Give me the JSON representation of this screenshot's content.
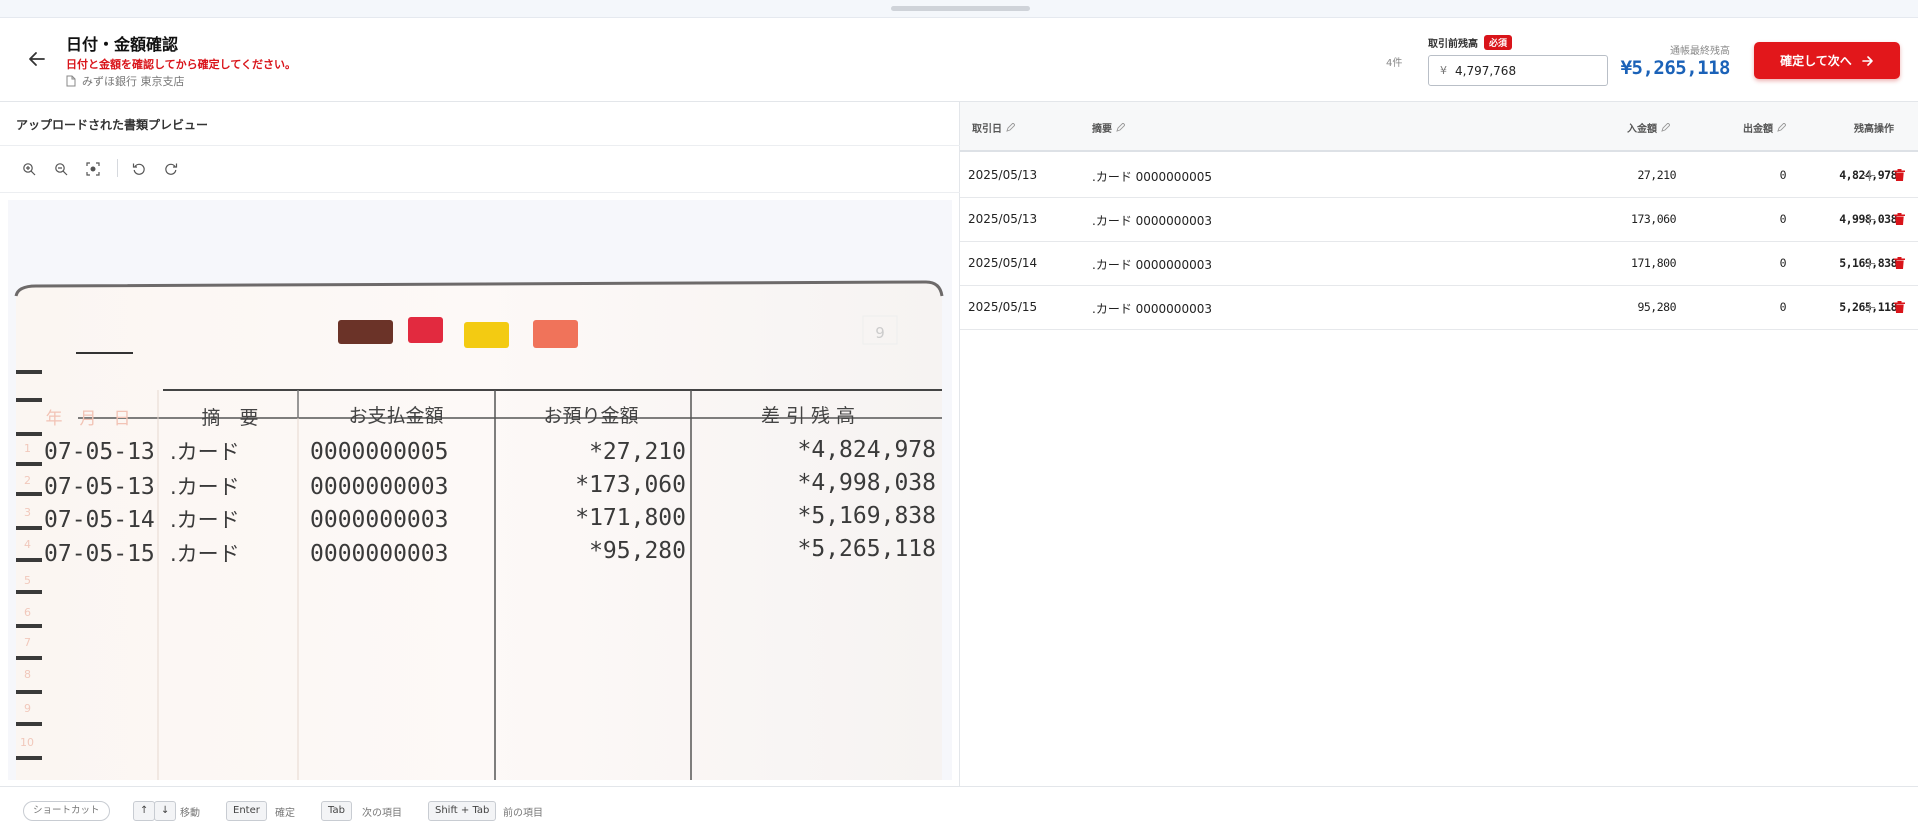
{
  "header": {
    "title": "日付・金額確認",
    "warning": "日付と金額を確認してから確定してください。",
    "bank": "みずほ銀行 東京支店",
    "count": "4件",
    "pre_balance_label": "取引前残高",
    "required": "必須",
    "pre_balance_currency": "¥",
    "pre_balance_value": "4,797,768",
    "final_balance_label": "通帳最終残高",
    "final_balance_value": "¥5,265,118",
    "confirm_label": "確定して次へ"
  },
  "preview": {
    "title": "アップロードされた書類プレビュー",
    "tools": [
      "zoom-in-icon",
      "zoom-out-icon",
      "fit-icon",
      "rotate-left-icon",
      "rotate-right-icon"
    ]
  },
  "passbook": {
    "page_no": "9",
    "headers": {
      "date": "年　月　日",
      "summary": "摘　要",
      "payment": "お支払金額",
      "deposit": "お預り金額",
      "balance": "差 引 残 高"
    },
    "rows": [
      {
        "date": "07-05-13",
        "summary": ".カード",
        "payment": "0000000005",
        "deposit": "*27,210",
        "balance": "*4,824,978"
      },
      {
        "date": "07-05-13",
        "summary": ".カード",
        "payment": "0000000003",
        "deposit": "*173,060",
        "balance": "*4,998,038"
      },
      {
        "date": "07-05-14",
        "summary": ".カード",
        "payment": "0000000003",
        "deposit": "*171,800",
        "balance": "*5,169,838"
      },
      {
        "date": "07-05-15",
        "summary": ".カード",
        "payment": "0000000003",
        "deposit": "*95,280",
        "balance": "*5,265,118"
      }
    ],
    "line_numbers": [
      "1",
      "2",
      "3",
      "4",
      "5",
      "6",
      "7",
      "8",
      "9",
      "10"
    ]
  },
  "table": {
    "headers": {
      "date": "取引日",
      "summary": "摘要",
      "deposit": "入金額",
      "withdrawal": "出金額",
      "balance": "残高",
      "action": "操作"
    },
    "rows": [
      {
        "date": "2025/05/13",
        "summary": ".カード 0000000005",
        "deposit": "27,210",
        "withdrawal": "0",
        "balance": "4,824,978"
      },
      {
        "date": "2025/05/13",
        "summary": ".カード 0000000003",
        "deposit": "173,060",
        "withdrawal": "0",
        "balance": "4,998,038"
      },
      {
        "date": "2025/05/14",
        "summary": ".カード 0000000003",
        "deposit": "171,800",
        "withdrawal": "0",
        "balance": "5,169,838"
      },
      {
        "date": "2025/05/15",
        "summary": ".カード 0000000003",
        "deposit": "95,280",
        "withdrawal": "0",
        "balance": "5,265,118"
      }
    ]
  },
  "footer": {
    "shortcut_label": "ショートカット",
    "up_key": "↑",
    "down_key": "↓",
    "move_label": "移動",
    "enter_key": "Enter",
    "enter_label": "確定",
    "tab_key": "Tab",
    "tab_label": "次の項目",
    "shift_tab_key": "Shift + Tab",
    "shift_tab_label": "前の項目"
  },
  "colors": {
    "accent_red": "#e2171b",
    "balance_blue": "#1b62b8"
  }
}
